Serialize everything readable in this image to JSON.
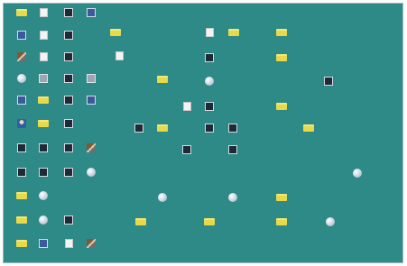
{
  "screen": {
    "wallpaper_color": "#2d8a86",
    "icons": [
      {
        "name": "folder-icon",
        "type": "folder",
        "label": ""
      },
      {
        "name": "doc-icon",
        "type": "doc",
        "label": ""
      },
      {
        "name": "exe-icon",
        "type": "exe",
        "label": ""
      },
      {
        "name": "app-icon",
        "type": "app",
        "label": ""
      },
      {
        "name": "computer-icon",
        "type": "app",
        "label": ""
      },
      {
        "name": "doc-icon",
        "type": "doc",
        "label": ""
      },
      {
        "name": "exe-icon",
        "type": "exe",
        "label": ""
      },
      {
        "name": "recycle-icon",
        "type": "tool",
        "label": ""
      },
      {
        "name": "doc-icon",
        "type": "doc",
        "label": ""
      },
      {
        "name": "exe-icon",
        "type": "exe",
        "label": ""
      },
      {
        "name": "globe-icon",
        "type": "globe",
        "label": ""
      },
      {
        "name": "disk-icon",
        "type": "disk",
        "label": ""
      },
      {
        "name": "exe-icon",
        "type": "exe",
        "label": ""
      },
      {
        "name": "disk-icon",
        "type": "disk",
        "label": ""
      },
      {
        "name": "app-icon",
        "type": "app",
        "label": ""
      },
      {
        "name": "folder-icon",
        "type": "folder",
        "label": ""
      },
      {
        "name": "exe-icon",
        "type": "exe",
        "label": ""
      },
      {
        "name": "app-icon",
        "type": "app",
        "label": ""
      },
      {
        "name": "user-icon",
        "type": "user",
        "label": ""
      },
      {
        "name": "folder-icon",
        "type": "folder",
        "label": ""
      },
      {
        "name": "exe-icon",
        "type": "exe",
        "label": ""
      },
      {
        "name": "exe-icon",
        "type": "exe",
        "label": ""
      },
      {
        "name": "exe-icon",
        "type": "exe",
        "label": ""
      },
      {
        "name": "exe-icon",
        "type": "exe",
        "label": ""
      },
      {
        "name": "tool-icon",
        "type": "tool",
        "label": ""
      },
      {
        "name": "exe-icon",
        "type": "exe",
        "label": ""
      },
      {
        "name": "exe-icon",
        "type": "exe",
        "label": ""
      },
      {
        "name": "exe-icon",
        "type": "exe",
        "label": ""
      },
      {
        "name": "globe-icon",
        "type": "globe",
        "label": ""
      },
      {
        "name": "folder-icon",
        "type": "folder",
        "label": ""
      },
      {
        "name": "globe-icon",
        "type": "globe",
        "label": ""
      },
      {
        "name": "folder-icon",
        "type": "folder",
        "label": ""
      },
      {
        "name": "globe-icon",
        "type": "globe",
        "label": ""
      },
      {
        "name": "exe-icon",
        "type": "exe",
        "label": ""
      },
      {
        "name": "folder-icon",
        "type": "folder",
        "label": ""
      },
      {
        "name": "app-icon",
        "type": "app",
        "label": ""
      },
      {
        "name": "doc-icon",
        "type": "doc",
        "label": ""
      },
      {
        "name": "tool-icon",
        "type": "tool",
        "label": ""
      },
      {
        "name": "folder-icon",
        "type": "folder",
        "label": ""
      },
      {
        "name": "doc-icon",
        "type": "doc",
        "label": ""
      },
      {
        "name": "folder-icon",
        "type": "folder",
        "label": ""
      },
      {
        "name": "exe-icon",
        "type": "exe",
        "label": ""
      },
      {
        "name": "exe-icon",
        "type": "exe",
        "label": ""
      },
      {
        "name": "folder-icon",
        "type": "folder",
        "label": ""
      },
      {
        "name": "globe-icon",
        "type": "globe",
        "label": ""
      },
      {
        "name": "exe-icon",
        "type": "exe",
        "label": ""
      },
      {
        "name": "doc-icon",
        "type": "doc",
        "label": ""
      },
      {
        "name": "folder-icon",
        "type": "folder",
        "label": ""
      },
      {
        "name": "exe-icon",
        "type": "exe",
        "label": ""
      },
      {
        "name": "globe-icon",
        "type": "globe",
        "label": ""
      },
      {
        "name": "folder-icon",
        "type": "folder",
        "label": ""
      },
      {
        "name": "folder-icon",
        "type": "folder",
        "label": ""
      },
      {
        "name": "exe-icon",
        "type": "exe",
        "label": ""
      },
      {
        "name": "folder-icon",
        "type": "folder",
        "label": ""
      },
      {
        "name": "exe-icon",
        "type": "exe",
        "label": ""
      },
      {
        "name": "doc-icon",
        "type": "doc",
        "label": ""
      },
      {
        "name": "exe-icon",
        "type": "exe",
        "label": ""
      },
      {
        "name": "exe-icon",
        "type": "exe",
        "label": ""
      },
      {
        "name": "globe-icon",
        "type": "globe",
        "label": ""
      },
      {
        "name": "folder-icon",
        "type": "folder",
        "label": ""
      },
      {
        "name": "globe-icon",
        "type": "globe",
        "label": ""
      },
      {
        "name": "folder-icon",
        "type": "folder",
        "label": ""
      },
      {
        "name": "globe-icon",
        "type": "globe",
        "label": ""
      },
      {
        "name": "folder-icon",
        "type": "folder",
        "label": ""
      },
      {
        "name": "folder-icon",
        "type": "folder",
        "label": ""
      },
      {
        "name": "folder-icon",
        "type": "folder",
        "label": ""
      }
    ]
  }
}
